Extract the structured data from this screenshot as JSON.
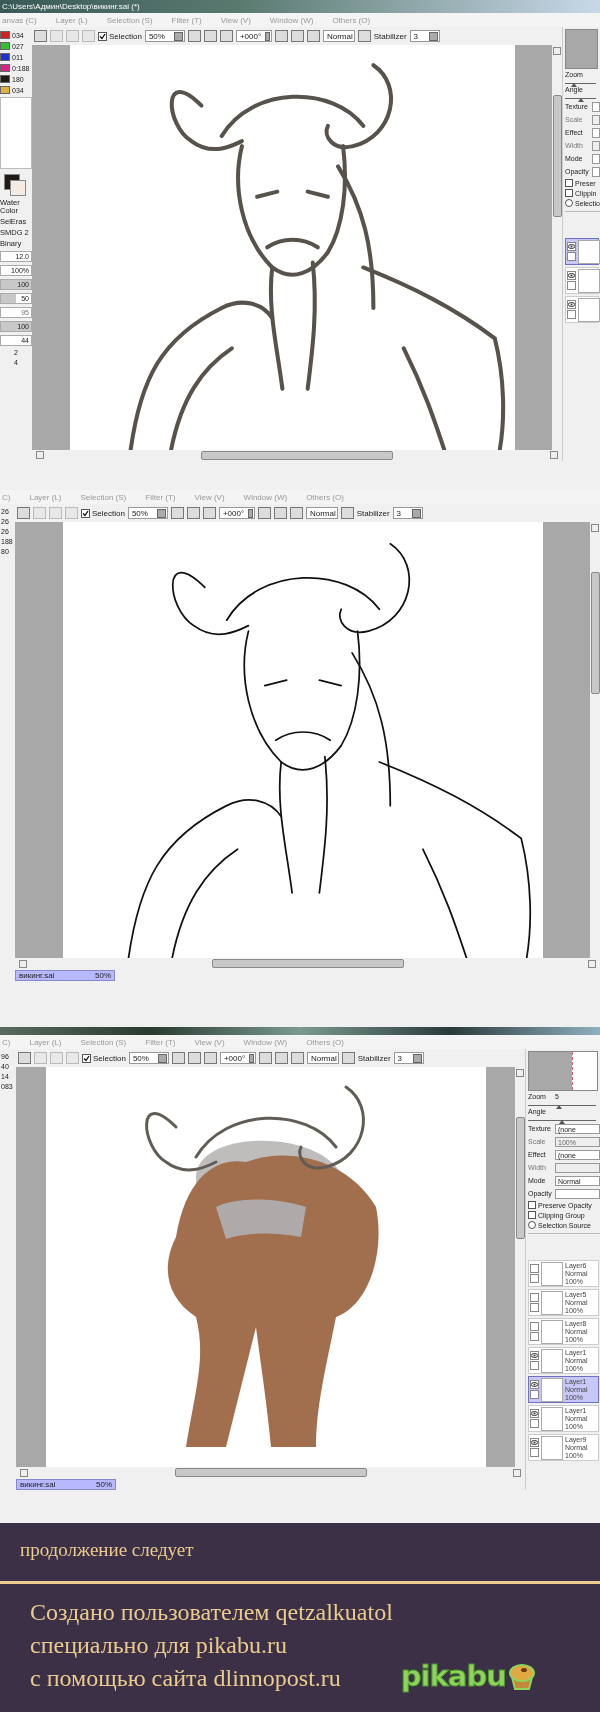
{
  "windows": [
    {
      "title": "C:\\Users\\Админ\\Desktop\\викинг.sai (*)",
      "menu": [
        "anvas (C)",
        "Layer (L)",
        "Selection (S)",
        "Filter (T)",
        "View (V)",
        "Window (W)",
        "Others (O)"
      ],
      "toolbar": {
        "selection_checked": true,
        "selection_label": "Selection",
        "zoom": "50%",
        "angle": "+000°",
        "mode": "Normal",
        "stabilizer_label": "Stabilizer",
        "stabilizer": "3"
      },
      "artwork": {
        "kind": "sketch"
      },
      "left_panel": [
        {
          "kind": "slider",
          "color": "#d42020",
          "value": "034"
        },
        {
          "kind": "slider",
          "color": "#30c030",
          "value": "027"
        },
        {
          "kind": "slider",
          "color": "#2030c8",
          "value": "011"
        },
        {
          "kind": "slider",
          "color": "#e02080",
          "value": "0:188"
        },
        {
          "kind": "slider",
          "color": "#201a14",
          "value": "180"
        },
        {
          "kind": "slider",
          "color": "#e0b040",
          "value": "034"
        },
        {
          "kind": "brush",
          "value": "Water Color"
        },
        {
          "kind": "brush",
          "value": "SelEras"
        },
        {
          "kind": "brush",
          "value": "SMDG 2"
        },
        {
          "kind": "brush",
          "value": "Binary"
        },
        {
          "kind": "field",
          "value": "12.0"
        },
        {
          "kind": "field",
          "value": "100%"
        },
        {
          "kind": "bar",
          "value": "100",
          "level": 1
        },
        {
          "kind": "bar",
          "value": "50",
          "level": 0.5
        },
        {
          "kind": "bar",
          "value": "95",
          "level": 0
        },
        {
          "kind": "bar",
          "value": "100",
          "level": 1
        },
        {
          "kind": "field",
          "value": "44"
        },
        {
          "kind": "size",
          "value": "2"
        },
        {
          "kind": "size",
          "value": "4"
        }
      ],
      "right_panel": {
        "rows": [
          {
            "kind": "slider",
            "label": "Zoom",
            "level": 0.3
          },
          {
            "kind": "slider",
            "label": "Angle",
            "level": 0.5
          },
          {
            "kind": "select",
            "label": "Texture"
          },
          {
            "kind": "select",
            "label": "Scale",
            "disabled": true
          },
          {
            "kind": "select",
            "label": "Effect"
          },
          {
            "kind": "select",
            "label": "Width",
            "disabled": true
          },
          {
            "kind": "select",
            "label": "Mode"
          },
          {
            "kind": "select",
            "label": "Opacity"
          },
          {
            "kind": "check",
            "label": "Preser",
            "checked": false
          },
          {
            "kind": "check",
            "label": "Clippin",
            "checked": false
          },
          {
            "kind": "radio",
            "label": "Selectio",
            "checked": false
          }
        ],
        "layers": [
          {
            "visible": true,
            "selected": true
          },
          {
            "visible": true,
            "selected": false
          },
          {
            "visible": true,
            "selected": false
          }
        ]
      }
    },
    {
      "menu": [
        "C)",
        "Layer (L)",
        "Selection (S)",
        "Filter (T)",
        "View (V)",
        "Window (W)",
        "Others (O)"
      ],
      "toolbar": {
        "selection_checked": true,
        "selection_label": "Selection",
        "zoom": "50%",
        "angle": "+000°",
        "mode": "Normal",
        "stabilizer_label": "Stabilizer",
        "stabilizer": "3"
      },
      "artwork": {
        "kind": "lineart"
      },
      "left_panel": [
        {
          "kind": "plain",
          "value": "26"
        },
        {
          "kind": "plain",
          "value": "26"
        },
        {
          "kind": "plain",
          "value": "26"
        },
        {
          "kind": "plain",
          "value": "188"
        },
        {
          "kind": "plain",
          "value": "80"
        }
      ],
      "file_tab": {
        "name": "викинг.sai",
        "zoom": "50%"
      }
    },
    {
      "menu": [
        "C)",
        "Layer (L)",
        "Selection (S)",
        "Filter (T)",
        "View (V)",
        "Window (W)",
        "Others (O)"
      ],
      "toolbar": {
        "selection_checked": true,
        "selection_label": "Selection",
        "zoom": "50%",
        "angle": "+000°",
        "mode": "Normal",
        "stabilizer_label": "Stabilizer",
        "stabilizer": "3"
      },
      "artwork": {
        "kind": "painted"
      },
      "left_panel": [
        {
          "kind": "plain",
          "value": "96"
        },
        {
          "kind": "plain",
          "value": "40"
        },
        {
          "kind": "plain",
          "value": "14"
        },
        {
          "kind": "plain",
          "value": "083"
        }
      ],
      "right_panel": {
        "rows": [
          {
            "kind": "slider",
            "label": "Zoom",
            "value": "5",
            "level": 0.45
          },
          {
            "kind": "slider",
            "label": "Angle",
            "level": 0.5
          },
          {
            "kind": "select",
            "label": "Texture",
            "value": "(none"
          },
          {
            "kind": "select",
            "label": "Scale",
            "value": "100%",
            "disabled": true
          },
          {
            "kind": "select",
            "label": "Effect",
            "value": "(none"
          },
          {
            "kind": "select",
            "label": "Width",
            "disabled": true
          },
          {
            "kind": "select",
            "label": "Mode",
            "value": "Normal"
          },
          {
            "kind": "select",
            "label": "Opacity"
          },
          {
            "kind": "check",
            "label": "Preserve Opacity",
            "checked": false
          },
          {
            "kind": "check",
            "label": "Clipping Group",
            "checked": false
          },
          {
            "kind": "radio",
            "label": "Selection Source",
            "checked": false
          }
        ],
        "layers": [
          {
            "name": "Layer6",
            "mode": "Normal",
            "opacity": "100%",
            "visible": false,
            "selected": false
          },
          {
            "name": "Layer5",
            "mode": "Normal",
            "opacity": "100%",
            "visible": false,
            "selected": false
          },
          {
            "name": "Layer8",
            "mode": "Normal",
            "opacity": "100%",
            "visible": false,
            "selected": false
          },
          {
            "name": "Layer1",
            "mode": "Normal",
            "opacity": "100%",
            "visible": true,
            "selected": false
          },
          {
            "name": "Layer1",
            "mode": "Normal",
            "opacity": "100%",
            "visible": true,
            "selected": true
          },
          {
            "name": "Layer1",
            "mode": "Normal",
            "opacity": "100%",
            "visible": true,
            "selected": false
          },
          {
            "name": "Layer9",
            "mode": "Normal",
            "opacity": "100%",
            "visible": true,
            "selected": false
          }
        ]
      },
      "file_tab": {
        "name": "викинг.sai",
        "zoom": "50%"
      }
    }
  ],
  "banner": {
    "note": "продолжение следует",
    "credits": [
      "Создано пользователем qetzalkuatol",
      "специально для pikabu.ru",
      "с помощью сайта dlinnopost.ru"
    ],
    "logo": "pikabu"
  }
}
